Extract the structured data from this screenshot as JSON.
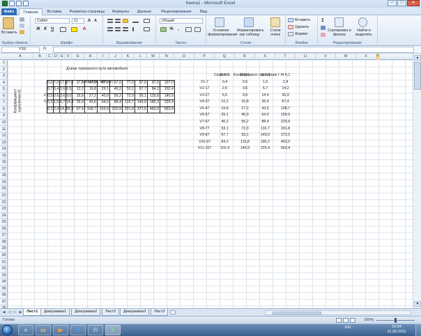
{
  "window": {
    "title": "Книга1 - Microsoft Excel",
    "minimize_glyph": "–",
    "maximize_glyph": "□",
    "close_glyph": "✕"
  },
  "ribbon_tabs": [
    "Файл",
    "Главная",
    "Вставка",
    "Разметка страницы",
    "Формулы",
    "Данные",
    "Рецензирование",
    "Вид"
  ],
  "ribbon": {
    "clipboard": {
      "label": "Буфер обмена",
      "paste": "Вставить"
    },
    "font": {
      "label": "Шрифт",
      "name": "Calibri",
      "size": "11"
    },
    "alignment": {
      "label": "Выравнивание"
    },
    "number": {
      "label": "Число",
      "format": "Общий"
    },
    "styles": {
      "label": "Стили",
      "conditional": "Условное форматирование",
      "as_table": "Форматировать как таблицу",
      "cell_styles": "Стили ячеек"
    },
    "cells": {
      "label": "Ячейки",
      "insert": "Вставить",
      "delete": "Удалить",
      "format": "Формат"
    },
    "editing": {
      "label": "Редактирование",
      "sort": "Сортировка и фильтр",
      "find": "Найти и выделить"
    }
  },
  "formula_bar": {
    "name_box": "Y39",
    "fx": "fx",
    "value": ""
  },
  "columns": [
    "A",
    "B",
    "C",
    "D",
    "E",
    "F",
    "G",
    "H",
    "I",
    "J",
    "K",
    "L",
    "M",
    "N",
    "O",
    "P",
    "Q",
    "R",
    "S",
    "T",
    "U",
    "V",
    "W",
    "X",
    "Y"
  ],
  "selected_column": "Y",
  "row_count": 40,
  "sheet": {
    "title": "Длина тормозного пути автомобиля",
    "speed_header": "Скорость, км/ч (V)",
    "coef_label_line1": "Коэффициент",
    "coef_label_line2": "сцепления (f)",
    "b5": "0",
    "b6": "0",
    "left_table": [
      [
        "0,0",
        "7,0",
        "17,0",
        "27,0",
        "37,0",
        "47,0",
        "57,0",
        "67,0",
        "77,0",
        "87,0",
        "97,0",
        "107,0"
      ],
      [
        "0,7",
        "0,4",
        "2,6",
        "6,5",
        "12,2",
        "19,8",
        "29,1",
        "40,2",
        "53,1",
        "67,7",
        "84,2",
        "102,4"
      ],
      [
        "0,5",
        "0,6",
        "3,6",
        "9,0",
        "16,8",
        "27,2",
        "40,0",
        "55,2",
        "72,9",
        "93,1",
        "115,8",
        "140,9"
      ],
      [
        "0,3",
        "1,0",
        "5,7",
        "14,4",
        "26,9",
        "43,5",
        "64,0",
        "88,4",
        "116,7",
        "149,0",
        "185,2",
        "225,4"
      ],
      [
        "0,1",
        "2,4",
        "14,2",
        "35,9",
        "67,4",
        "108,7",
        "159,9",
        "220,9",
        "291,8",
        "372,5",
        "463,0",
        "563,4"
      ]
    ],
    "right_header": {
      "speed": "Скорость",
      "coef": "Коэффициент сцепления f"
    },
    "right_cols": [
      "f1-0,7",
      "f2-0,5",
      "f3-0,3",
      "f4-0,1"
    ],
    "right_rows": [
      {
        "label": "V1-7",
        "vals": [
          "0,4",
          "0,6",
          "1,0",
          "2,4"
        ]
      },
      {
        "label": "V2-17",
        "vals": [
          "2,6",
          "3,6",
          "5,7",
          "14,2"
        ]
      },
      {
        "label": "V3-27",
        "vals": [
          "6,5",
          "9,0",
          "14,4",
          "35,9"
        ]
      },
      {
        "label": "V4-37",
        "vals": [
          "12,2",
          "16,8",
          "26,9",
          "67,4"
        ]
      },
      {
        "label": "V5-47",
        "vals": [
          "19,8",
          "27,2",
          "43,5",
          "108,7"
        ]
      },
      {
        "label": "V6-57",
        "vals": [
          "29,1",
          "40,0",
          "64,0",
          "159,9"
        ]
      },
      {
        "label": "V7-67",
        "vals": [
          "40,2",
          "55,2",
          "88,4",
          "220,9"
        ]
      },
      {
        "label": "V8-77",
        "vals": [
          "53,1",
          "72,9",
          "116,7",
          "291,8"
        ]
      },
      {
        "label": "V9-87",
        "vals": [
          "67,7",
          "93,1",
          "149,0",
          "372,5"
        ]
      },
      {
        "label": "V10-97",
        "vals": [
          "84,2",
          "115,8",
          "185,2",
          "463,0"
        ]
      },
      {
        "label": "V11-107",
        "vals": [
          "102,4",
          "140,9",
          "225,4",
          "563,4"
        ]
      }
    ]
  },
  "sheet_tabs": [
    "Лист1",
    "Диаграмма1",
    "Диаграмма2",
    "Лист2",
    "Диаграмма3",
    "Лист3"
  ],
  "active_sheet": "Лист1",
  "status": {
    "ready": "Готово",
    "zoom": "100%"
  },
  "taskbar": {
    "lang": "EN",
    "time": "19:54",
    "date": "21.03.2011",
    "apps": [
      "IE",
      "Folder",
      "Media",
      "Skype",
      "Word",
      "Excel"
    ]
  }
}
